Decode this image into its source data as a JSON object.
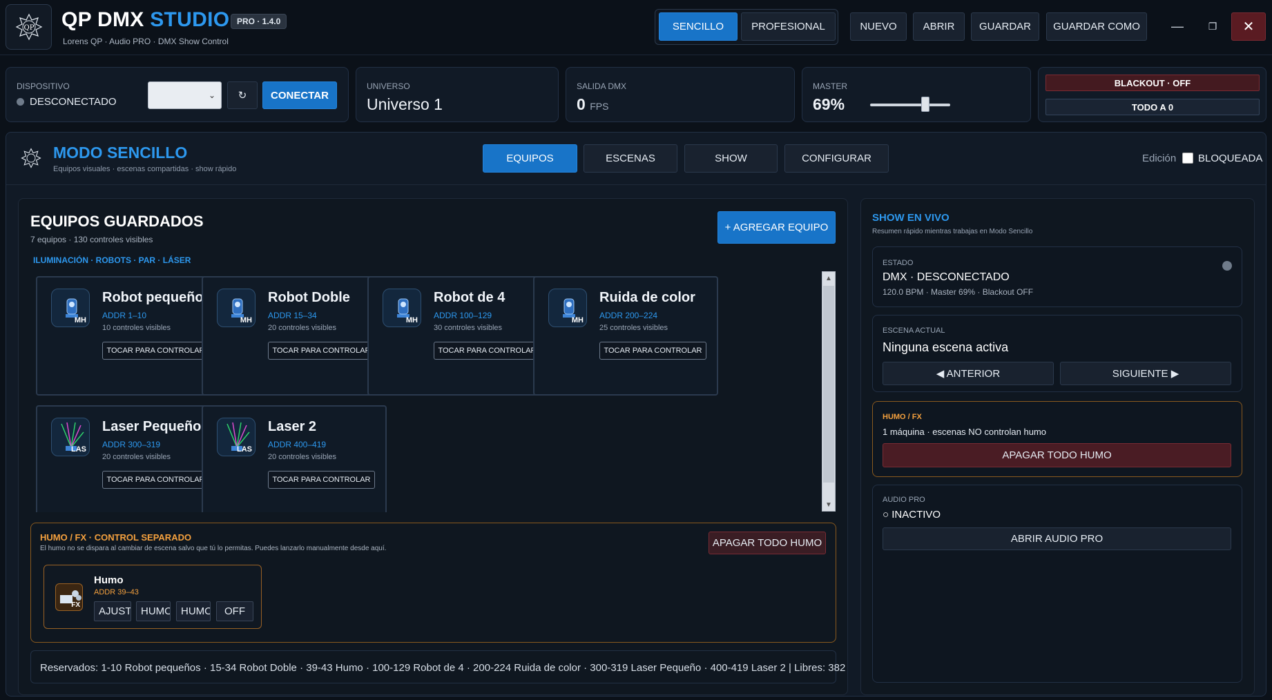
{
  "header": {
    "app_name": "QP DMX",
    "app_name_accent": "STUDIO",
    "version": "PRO · 1.4.0",
    "subtitle": "Lorens QP · Audio PRO · DMX Show Control",
    "logo_text": "QP",
    "mode_simple": "SENCILLO",
    "mode_pro": "PROFESIONAL",
    "new": "NUEVO",
    "open": "ABRIR",
    "save": "GUARDAR",
    "save_as": "GUARDAR COMO",
    "minimize": "—",
    "maximize": "❐",
    "close": "✕"
  },
  "status": {
    "device_label": "DISPOSITIVO",
    "device_state": "DESCONECTADO",
    "device_select_value": "",
    "refresh": "↻",
    "connect": "CONECTAR",
    "universe_label": "UNIVERSO",
    "universe_value": "Universo 1",
    "dmx_label": "SALIDA DMX",
    "dmx_value": "0",
    "dmx_unit": "FPS",
    "master_label": "MASTER",
    "master_value": "69%",
    "master_level": 0.69,
    "blackout": "BLACKOUT · OFF",
    "all_zero": "TODO A 0"
  },
  "mode": {
    "title": "MODO SENCILLO",
    "subtitle": "Equipos visuales · escenas compartidas · show rápido",
    "tabs": [
      "EQUIPOS",
      "ESCENAS",
      "SHOW",
      "CONFIGURAR"
    ],
    "edit_label": "Edición",
    "lock_label": "BLOQUEADA"
  },
  "equipment": {
    "title": "EQUIPOS GUARDADOS",
    "count": "7 equipos · 130 controles visibles",
    "filter": "ILUMINACIÓN · ROBOTS · PAR · LÁSER",
    "add_button": "+ AGREGAR EQUIPO",
    "cards": [
      {
        "name": "Robot pequeños",
        "addr": "ADDR 1–10",
        "controls": "10 controles visibles",
        "button": "TOCAR PARA CONTROLAR",
        "tag": "MH",
        "icon": "moving-head-icon"
      },
      {
        "name": "Robot Doble",
        "addr": "ADDR 15–34",
        "controls": "20 controles visibles",
        "button": "TOCAR PARA CONTROLAR",
        "tag": "MH",
        "icon": "moving-head-icon"
      },
      {
        "name": "Robot de 4",
        "addr": "ADDR 100–129",
        "controls": "30 controles visibles",
        "button": "TOCAR PARA CONTROLAR",
        "tag": "MH",
        "icon": "moving-head-icon"
      },
      {
        "name": "Ruida de color",
        "addr": "ADDR 200–224",
        "controls": "25 controles visibles",
        "button": "TOCAR PARA CONTROLAR",
        "tag": "MH",
        "icon": "moving-head-icon"
      },
      {
        "name": "Laser Pequeño",
        "addr": "ADDR 300–319",
        "controls": "20 controles visibles",
        "button": "TOCAR PARA CONTROLAR",
        "tag": "LAS",
        "icon": "laser-icon"
      },
      {
        "name": "Laser 2",
        "addr": "ADDR 400–419",
        "controls": "20 controles visibles",
        "button": "TOCAR PARA CONTROLAR",
        "tag": "LAS",
        "icon": "laser-icon"
      }
    ]
  },
  "fx": {
    "title": "HUMO / FX · CONTROL SEPARADO",
    "desc": "El humo no se dispara al cambiar de escena salvo que tú lo permitas. Puedes lanzarlo manualmente desde aquí.",
    "off_button": "APAGAR TODO HUMO",
    "device_name": "Humo",
    "device_addr": "ADDR 39–43",
    "device_tag": "FX",
    "buttons": [
      "AJUST",
      "HUMO",
      "HUMO",
      "OFF"
    ]
  },
  "reserved": "Reservados: 1-10 Robot pequeños · 15-34 Robot Doble · 39-43 Humo · 100-129 Robot de 4 · 200-224 Ruida de color · 300-319 Laser Pequeño · 400-419 Laser 2   |   Libres: 382",
  "show": {
    "title": "SHOW EN VIVO",
    "subtitle": "Resumen rápido mientras trabajas en Modo Sencillo",
    "state_label": "ESTADO",
    "state_value": "DMX · DESCONECTADO",
    "state_meta": "120.0 BPM · Master 69% · Blackout OFF",
    "scene_label": "ESCENA ACTUAL",
    "scene_value": "Ninguna escena activa",
    "prev": "◀ ANTERIOR",
    "next": "SIGUIENTE ▶",
    "smoke_label": "HUMO / FX",
    "smoke_desc": "1 máquina · escenas NO controlan humo",
    "smoke_off": "APAGAR TODO HUMO",
    "audio_label": "AUDIO PRO",
    "audio_state": "○ INACTIVO",
    "audio_open": "ABRIR AUDIO PRO"
  }
}
